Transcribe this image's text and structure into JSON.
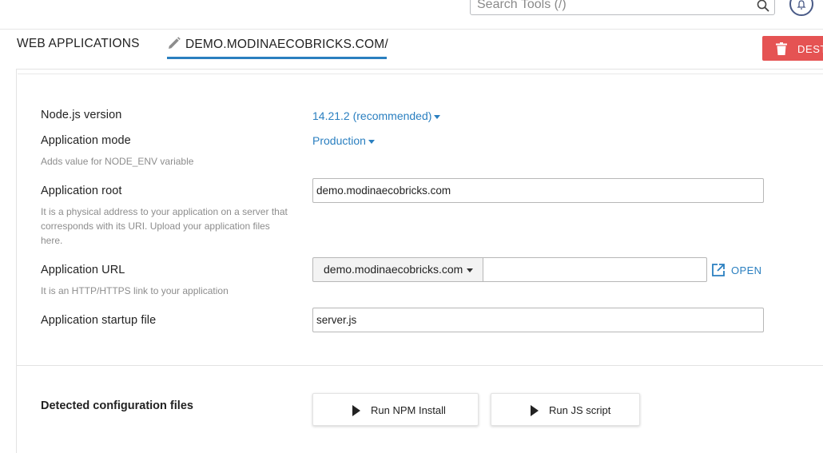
{
  "header": {
    "search_placeholder": "Search Tools (/)",
    "icons": {
      "search": "search-icon",
      "notifications": "bell-icon"
    }
  },
  "breadcrumb": {
    "home": "WEB APPLICATIONS",
    "current": "DEMO.MODINAECOBRICKS.COM/",
    "icon": "pencil-icon"
  },
  "actions": {
    "destroy_label": "DESTROY",
    "destroy_icon": "trash-icon",
    "destroy_color": "#e55353"
  },
  "form": {
    "node_version": {
      "label": "Node.js version",
      "value": "14.21.2 (recommended)"
    },
    "app_mode": {
      "label": "Application mode",
      "value": "Production",
      "hint": "Adds value for NODE_ENV variable"
    },
    "app_root": {
      "label": "Application root",
      "value": "demo.modinaecobricks.com",
      "hint": "It is a physical address to your application on a server that corresponds with its URI. Upload your application files here."
    },
    "app_url": {
      "label": "Application URL",
      "domain": "demo.modinaecobricks.com",
      "path": "",
      "open_label": "OPEN",
      "hint": "It is an HTTP/HTTPS link to your application"
    },
    "startup_file": {
      "label": "Application startup file",
      "value": "server.js"
    }
  },
  "config": {
    "title": "Detected configuration files",
    "npm_button": "Run NPM Install",
    "js_button": "Run JS script"
  },
  "colors": {
    "accent": "#2a7fc0",
    "danger": "#e55353"
  }
}
